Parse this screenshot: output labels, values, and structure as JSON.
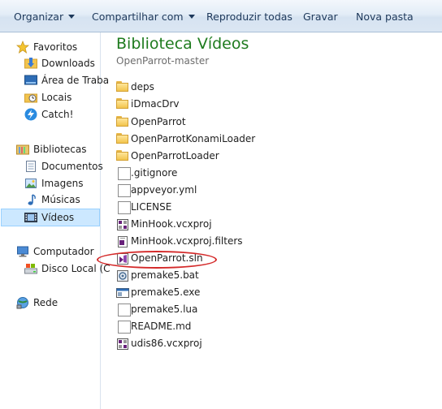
{
  "toolbar": {
    "organize": "Organizar",
    "share": "Compartilhar com",
    "play_all": "Reproduzir todas",
    "burn": "Gravar",
    "new_folder": "Nova pasta"
  },
  "nav": {
    "favorites": "Favoritos",
    "downloads": "Downloads",
    "desktop": "Área de Traba",
    "places": "Locais",
    "catch": "Catch!",
    "libraries": "Bibliotecas",
    "documents": "Documentos",
    "images": "Imagens",
    "music": "Músicas",
    "videos": "Vídeos",
    "computer": "Computador",
    "local_disk": "Disco Local (C",
    "network": "Rede"
  },
  "header": {
    "title": "Biblioteca Vídeos",
    "subtitle": "OpenParrot-master"
  },
  "files": [
    {
      "name": "deps",
      "type": "folder"
    },
    {
      "name": "iDmacDrv",
      "type": "folder"
    },
    {
      "name": "OpenParrot",
      "type": "folder"
    },
    {
      "name": "OpenParrotKonamiLoader",
      "type": "folder"
    },
    {
      "name": "OpenParrotLoader",
      "type": "folder"
    },
    {
      "name": ".gitignore",
      "type": "file"
    },
    {
      "name": "appveyor.yml",
      "type": "file"
    },
    {
      "name": "LICENSE",
      "type": "file"
    },
    {
      "name": "MinHook.vcxproj",
      "type": "vcxproj"
    },
    {
      "name": "MinHook.vcxproj.filters",
      "type": "filters"
    },
    {
      "name": "OpenParrot.sln",
      "type": "sln"
    },
    {
      "name": "premake5.bat",
      "type": "bat"
    },
    {
      "name": "premake5.exe",
      "type": "exe"
    },
    {
      "name": "premake5.lua",
      "type": "file"
    },
    {
      "name": "README.md",
      "type": "file"
    },
    {
      "name": "udis86.vcxproj",
      "type": "vcxproj"
    }
  ],
  "colors": {
    "title": "#1e7b1e",
    "highlight_circle": "#d42a2a",
    "selection": "#cce8ff"
  }
}
